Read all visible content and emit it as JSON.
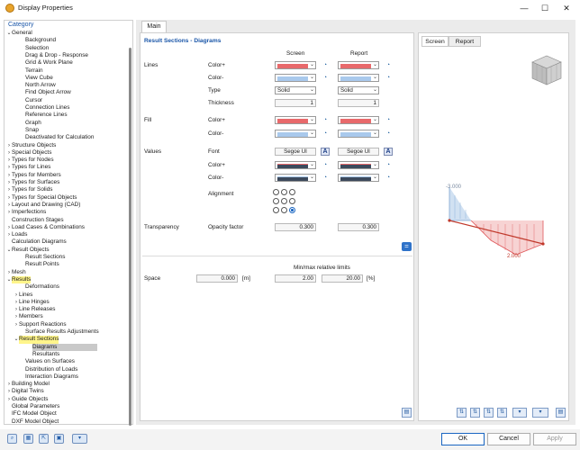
{
  "window": {
    "title": "Display Properties",
    "min_glyph": "—",
    "max_glyph": "☐",
    "close_glyph": "✕"
  },
  "left": {
    "category_label": "Category",
    "tree": [
      {
        "label": "General",
        "level": 0,
        "chev": "down"
      },
      {
        "label": "Background",
        "level": 2
      },
      {
        "label": "Selection",
        "level": 2
      },
      {
        "label": "Drag & Drop - Response",
        "level": 2
      },
      {
        "label": "Grid & Work Plane",
        "level": 2
      },
      {
        "label": "Terrain",
        "level": 2
      },
      {
        "label": "View Cube",
        "level": 2
      },
      {
        "label": "North Arrow",
        "level": 2
      },
      {
        "label": "Find Object Arrow",
        "level": 2
      },
      {
        "label": "Cursor",
        "level": 2
      },
      {
        "label": "Connection Lines",
        "level": 2
      },
      {
        "label": "Reference Lines",
        "level": 2
      },
      {
        "label": "Graph",
        "level": 2
      },
      {
        "label": "Snap",
        "level": 2
      },
      {
        "label": "Deactivated for Calculation",
        "level": 2
      },
      {
        "label": "Structure Objects",
        "level": 0,
        "chev": "right"
      },
      {
        "label": "Special Objects",
        "level": 0,
        "chev": "right"
      },
      {
        "label": "Types for Nodes",
        "level": 0,
        "chev": "right"
      },
      {
        "label": "Types for Lines",
        "level": 0,
        "chev": "right"
      },
      {
        "label": "Types for Members",
        "level": 0,
        "chev": "right"
      },
      {
        "label": "Types for Surfaces",
        "level": 0,
        "chev": "right"
      },
      {
        "label": "Types for Solids",
        "level": 0,
        "chev": "right"
      },
      {
        "label": "Types for Special Objects",
        "level": 0,
        "chev": "right"
      },
      {
        "label": "Layout and Drawing (CAD)",
        "level": 0,
        "chev": "right"
      },
      {
        "label": "Imperfections",
        "level": 0,
        "chev": "right"
      },
      {
        "label": "Construction Stages",
        "level": 0
      },
      {
        "label": "Load Cases & Combinations",
        "level": 0,
        "chev": "right"
      },
      {
        "label": "Loads",
        "level": 0,
        "chev": "right"
      },
      {
        "label": "Calculation Diagrams",
        "level": 0
      },
      {
        "label": "Result Objects",
        "level": 0,
        "chev": "down"
      },
      {
        "label": "Result Sections",
        "level": 2
      },
      {
        "label": "Result Points",
        "level": 2
      },
      {
        "label": "Mesh",
        "level": 0,
        "chev": "right"
      },
      {
        "label": "Results",
        "level": 0,
        "chev": "down",
        "hl": true
      },
      {
        "label": "Deformations",
        "level": 2
      },
      {
        "label": "Lines",
        "level": 1,
        "chev": "right"
      },
      {
        "label": "Line Hinges",
        "level": 1,
        "chev": "right"
      },
      {
        "label": "Line Releases",
        "level": 1,
        "chev": "right"
      },
      {
        "label": "Members",
        "level": 1,
        "chev": "right"
      },
      {
        "label": "Support Reactions",
        "level": 1,
        "chev": "right"
      },
      {
        "label": "Surface Results Adjustments",
        "level": 2
      },
      {
        "label": "Result Sections",
        "level": 1,
        "chev": "down",
        "hl": true
      },
      {
        "label": "Diagrams",
        "level": 3,
        "sel": true
      },
      {
        "label": "Resultants",
        "level": 3
      },
      {
        "label": "Values on Surfaces",
        "level": 2
      },
      {
        "label": "Distribution of Loads",
        "level": 2
      },
      {
        "label": "Interaction Diagrams",
        "level": 2
      },
      {
        "label": "Building Model",
        "level": 0,
        "chev": "right"
      },
      {
        "label": "Digital Twins",
        "level": 0,
        "chev": "right"
      },
      {
        "label": "Guide Objects",
        "level": 0,
        "chev": "right"
      },
      {
        "label": "Global Parameters",
        "level": 0
      },
      {
        "label": "IFC Model Object",
        "level": 0
      },
      {
        "label": "DXF Model Object",
        "level": 0
      }
    ]
  },
  "main_tab": "Main",
  "section_title": "Result Sections - Diagrams",
  "headers": {
    "screen": "Screen",
    "report": "Report"
  },
  "groups": {
    "lines": "Lines",
    "fill": "Fill",
    "values": "Values",
    "transparency": "Transparency",
    "space": "Space"
  },
  "rows": {
    "color_plus": "Color+",
    "color_minus": "Color-",
    "type": "Type",
    "thickness": "Thickness",
    "font": "Font",
    "alignment": "Alignment",
    "opacity": "Opacity factor"
  },
  "values": {
    "type_screen": "Solid",
    "type_report": "Solid",
    "thickness_screen": "1",
    "thickness_report": "1",
    "font_screen": "Segoe UI",
    "font_report": "Segoe UI",
    "font_btn": "A",
    "opacity_screen": "0.300",
    "opacity_report": "0.300",
    "minmax_label": "Min/max relative limits",
    "space_value": "0.000",
    "space_unit": "[m]",
    "min_value": "2.00",
    "max_value": "20.00",
    "pct_unit": "[%]"
  },
  "colors": {
    "red": "#e8696b",
    "blue": "#a9c9ec",
    "dark": "#3d4a5c",
    "accent": "#1a66c2"
  },
  "preview": {
    "tabs": [
      "Screen",
      "Report"
    ],
    "value_neg": "-3.000",
    "value_pos": "2.000"
  },
  "bottom": {
    "ok": "OK",
    "cancel": "Cancel",
    "apply": "Apply"
  }
}
